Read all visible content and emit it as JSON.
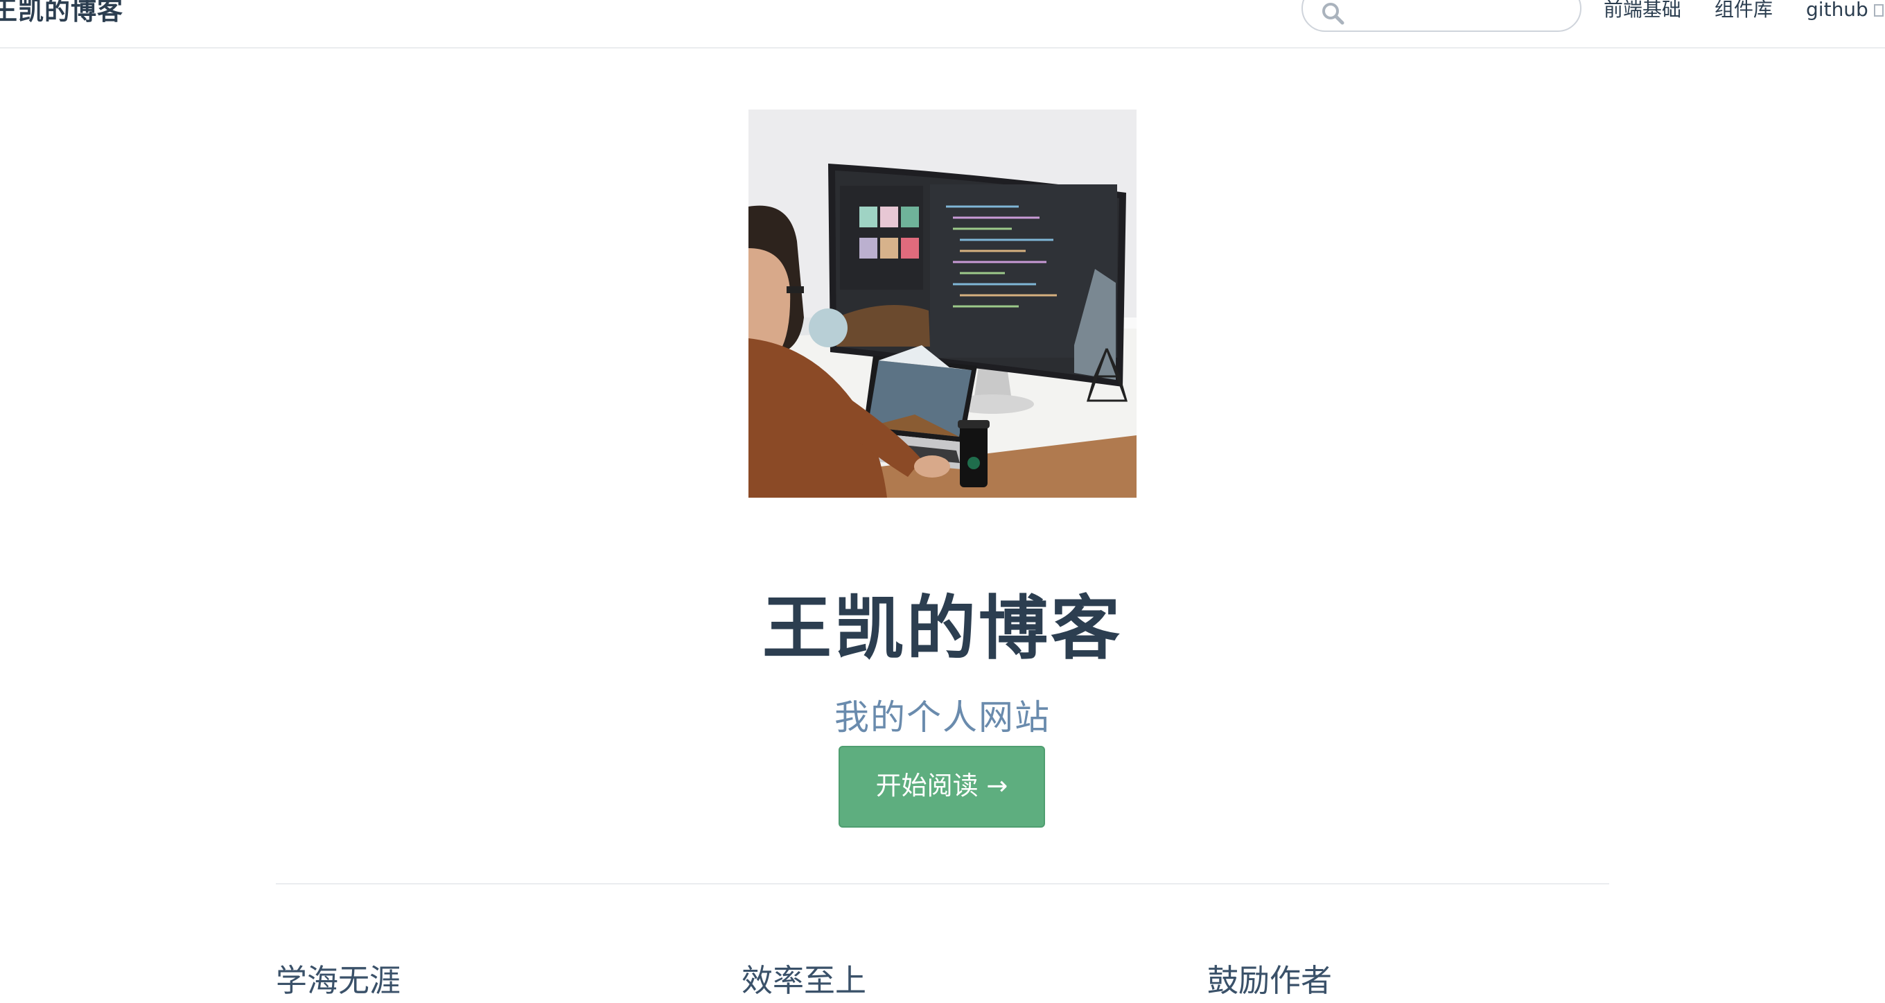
{
  "navbar": {
    "site_name": "王凯的博客",
    "search": {
      "placeholder": "",
      "value": ""
    },
    "links": [
      {
        "label": "前端基础"
      },
      {
        "label": "组件库"
      },
      {
        "label": "github"
      }
    ]
  },
  "hero": {
    "image_alt": "person working at a desk with a curved monitor and a laptop",
    "title": "王凯的博客",
    "description": "我的个人网站",
    "action_label": "开始阅读 →"
  },
  "features": [
    {
      "title": "学海无涯"
    },
    {
      "title": "效率至上"
    },
    {
      "title": "鼓励作者"
    }
  ],
  "colors": {
    "accent": "#5eae7f",
    "text": "#2c3e50",
    "description": "#6a8bad",
    "border": "#eaecef"
  }
}
